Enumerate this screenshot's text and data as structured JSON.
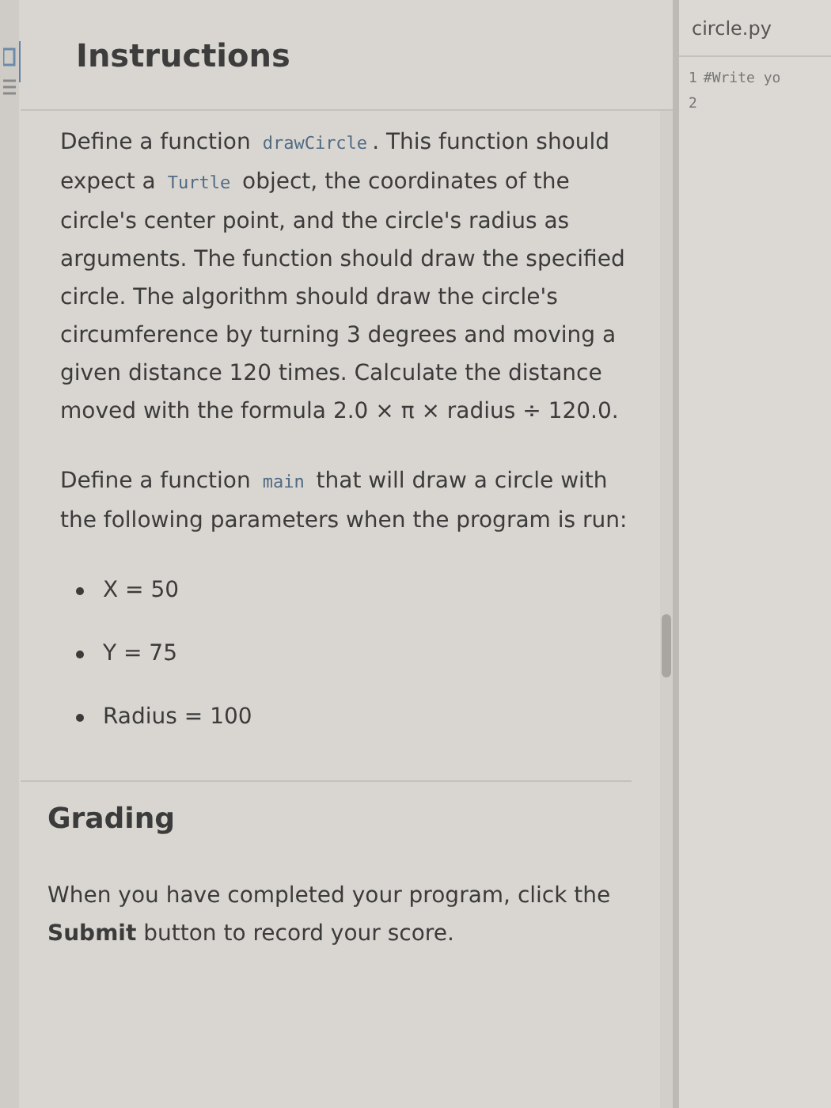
{
  "instructions": {
    "title": "Instructions",
    "paragraphs": [
      [
        {
          "kind": "text",
          "text": "Define a function "
        },
        {
          "kind": "code",
          "text": "drawCircle"
        },
        {
          "kind": "text",
          "text": ". This function should expect a "
        },
        {
          "kind": "code",
          "text": "Turtle"
        },
        {
          "kind": "text",
          "text": " object, the coordinates of the circle's center point, and the circle's radius as arguments. The function should draw the specified circle. The algorithm should draw the circle's circumference by turning 3 degrees and moving a given distance 120 times. Calculate the distance moved with the formula 2.0 × π × radius ÷ 120.0."
        }
      ],
      [
        {
          "kind": "text",
          "text": "Define a function "
        },
        {
          "kind": "code",
          "text": "main"
        },
        {
          "kind": "text",
          "text": " that will draw a circle with the following parameters when the program is run:"
        }
      ]
    ],
    "bullets": [
      "X = 50",
      "Y = 75",
      "Radius = 100"
    ],
    "grading_title": "Grading",
    "grading_text": "When you have completed your program, click the **Submit** button to record your score."
  },
  "editor": {
    "tab": "circle.py",
    "lines": [
      {
        "number": "1",
        "code": "#Write yo"
      },
      {
        "number": "2"
      }
    ]
  }
}
